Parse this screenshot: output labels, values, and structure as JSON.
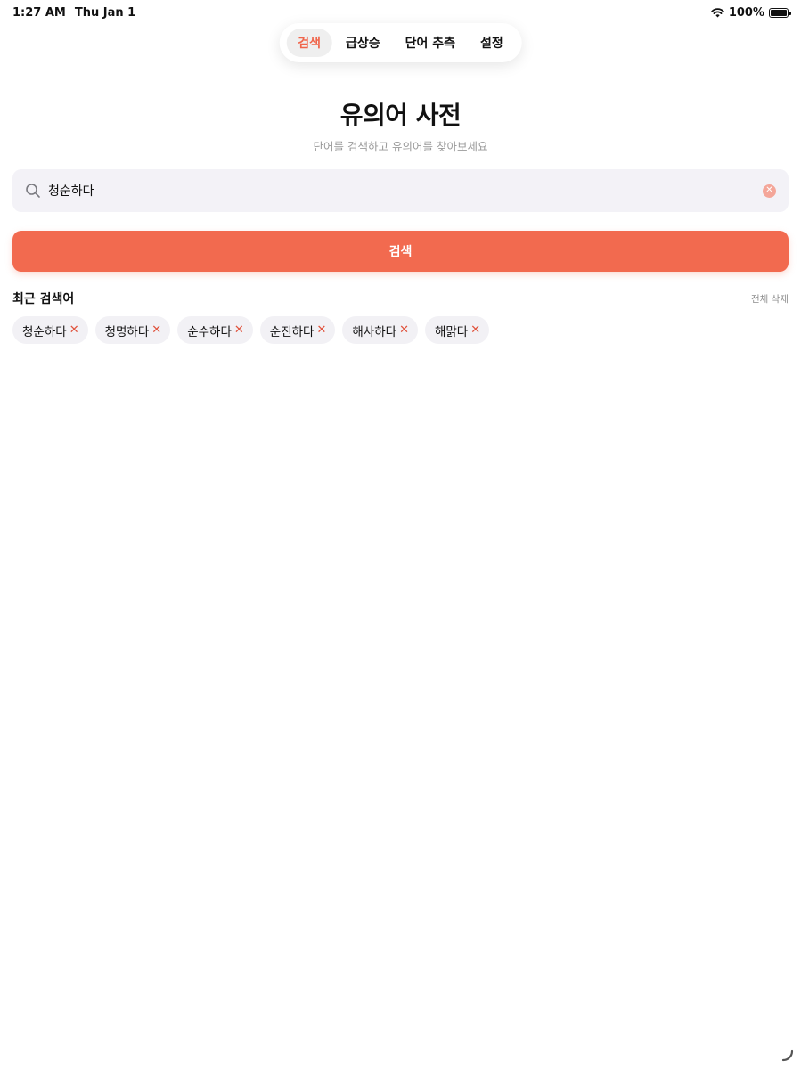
{
  "status_bar": {
    "time": "1:27 AM",
    "date": "Thu Jan 1",
    "battery": "100%"
  },
  "nav": {
    "tabs": [
      {
        "label": "검색",
        "active": true
      },
      {
        "label": "급상승",
        "active": false
      },
      {
        "label": "단어 추측",
        "active": false
      },
      {
        "label": "설정",
        "active": false
      }
    ]
  },
  "header": {
    "title": "유의어 사전",
    "subtitle": "단어를 검색하고 유의어를 찾아보세요"
  },
  "search": {
    "value": "청순하다",
    "button_label": "검색"
  },
  "recent": {
    "title": "최근 검색어",
    "clear_all_label": "전체 삭제",
    "items": [
      "청순하다",
      "청명하다",
      "순수하다",
      "순진하다",
      "해사하다",
      "해맑다"
    ]
  },
  "colors": {
    "accent": "#f26a4f",
    "active_tab_text": "#f0654b",
    "field_bg": "#f3f2f7",
    "chip_bg": "#f2f1f5",
    "chip_remove": "#e0533d",
    "clear_icon": "#f4a699"
  },
  "icons": {
    "search": "search-icon",
    "clear": "clear-icon",
    "chip_remove": "close-icon",
    "wifi": "wifi-icon",
    "battery": "battery-icon"
  }
}
